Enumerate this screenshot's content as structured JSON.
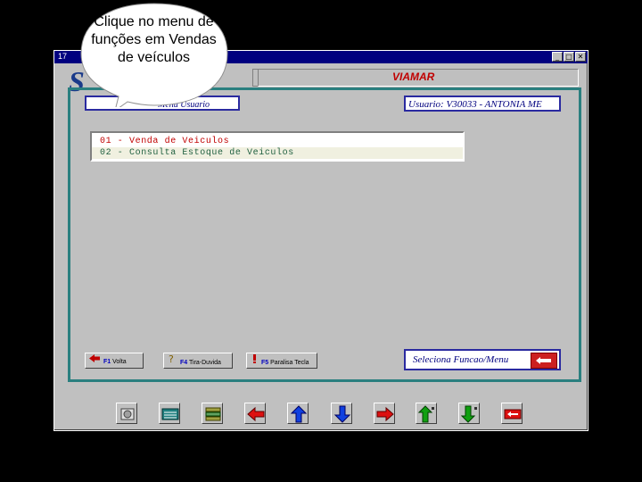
{
  "window": {
    "title": "17",
    "controls": {
      "minimize": "_",
      "maximize": "□",
      "close": "✕"
    }
  },
  "header": {
    "logo_letter": "S",
    "company": "VIAMAR"
  },
  "info": {
    "rotina": "Rotina: Menu Usuario",
    "rotina_visible": "Menu Usuario",
    "usuario": "Usuario: V30033 - ANTONIA ME"
  },
  "menu": {
    "items": [
      {
        "label": "01 - Venda de Veiculos",
        "selected": true
      },
      {
        "label": "02 - Consulta Estoque de Veiculos",
        "selected": false
      }
    ]
  },
  "function_buttons": {
    "f1": {
      "key": "F1",
      "label": "Volta"
    },
    "f4": {
      "key": "F4",
      "label": "Tira-Duvida"
    },
    "f5": {
      "key": "F5",
      "label": "Paralisa Tecla"
    }
  },
  "seleciona": {
    "label": "Seleciona Funcao/Menu"
  },
  "toolbar": {
    "icons": [
      "calculator-icon",
      "keyboard-icon",
      "stack-icon",
      "arrow-left-icon",
      "arrow-up-icon",
      "arrow-down-icon",
      "arrow-right-icon",
      "page-up-icon",
      "page-down-icon",
      "enter-icon"
    ]
  },
  "callout": {
    "text": "Clique no menu de funções em Vendas de veículos"
  },
  "colors": {
    "title_bar": "#00007f",
    "frame_border": "#2a7f7f",
    "selected_item": "#c00000",
    "normal_item": "#206040"
  }
}
